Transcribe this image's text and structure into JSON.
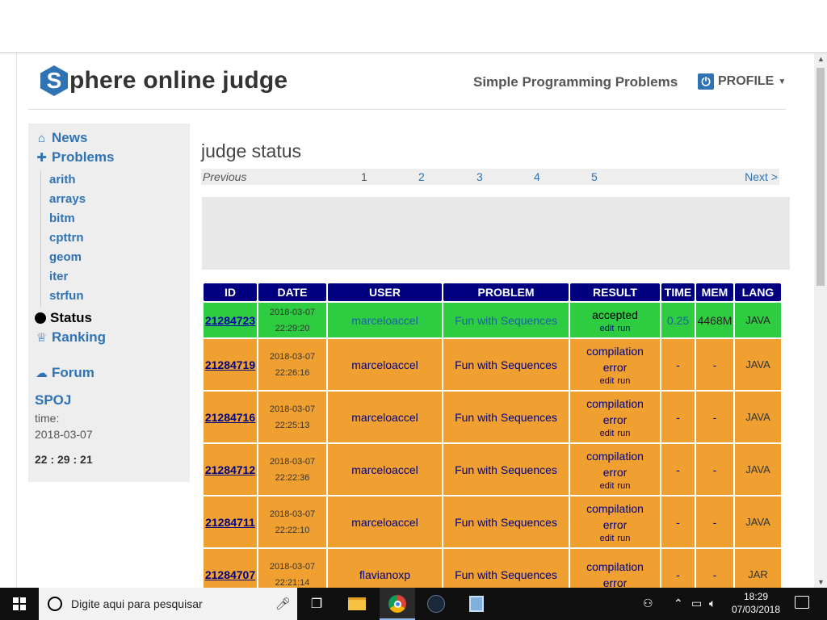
{
  "header": {
    "logo_letter": "S",
    "logo_text": "phere online judge",
    "link": "Simple Programming Problems",
    "profile": "PROFILE"
  },
  "sidebar": {
    "news": "News",
    "problems": "Problems",
    "subs": [
      "arith",
      "arrays",
      "bitm",
      "cpttrn",
      "geom",
      "iter",
      "strfun"
    ],
    "status": "Status",
    "ranking": "Ranking",
    "forum": "Forum",
    "spoj": "SPOJ",
    "time_label": "time:",
    "date": "2018-03-07",
    "clock": "22 : 29 : 21"
  },
  "main": {
    "title": "judge status",
    "pager": {
      "prev": "Previous",
      "pages": [
        "1",
        "2",
        "3",
        "4",
        "5"
      ],
      "next": "Next >"
    }
  },
  "table": {
    "headers": [
      "ID",
      "DATE",
      "USER",
      "PROBLEM",
      "RESULT",
      "TIME",
      "MEM",
      "LANG"
    ],
    "edit_label": "edit",
    "run_label": "run",
    "rows": [
      {
        "id": "21284723",
        "date": "2018-03-07",
        "time_of_day": "22:29:20",
        "user": "marceloaccel",
        "problem": "Fun with Sequences",
        "result": "accepted",
        "time": "0.25",
        "mem": "4468M",
        "lang": "JAVA",
        "status": "accepted"
      },
      {
        "id": "21284719",
        "date": "2018-03-07",
        "time_of_day": "22:26:16",
        "user": "marceloaccel",
        "problem": "Fun with Sequences",
        "result": "compilation error",
        "time": "-",
        "mem": "-",
        "lang": "JAVA",
        "status": "error"
      },
      {
        "id": "21284716",
        "date": "2018-03-07",
        "time_of_day": "22:25:13",
        "user": "marceloaccel",
        "problem": "Fun with Sequences",
        "result": "compilation error",
        "time": "-",
        "mem": "-",
        "lang": "JAVA",
        "status": "error"
      },
      {
        "id": "21284712",
        "date": "2018-03-07",
        "time_of_day": "22:22:36",
        "user": "marceloaccel",
        "problem": "Fun with Sequences",
        "result": "compilation error",
        "time": "-",
        "mem": "-",
        "lang": "JAVA",
        "status": "error"
      },
      {
        "id": "21284711",
        "date": "2018-03-07",
        "time_of_day": "22:22:10",
        "user": "marceloaccel",
        "problem": "Fun with Sequences",
        "result": "compilation error",
        "time": "-",
        "mem": "-",
        "lang": "JAVA",
        "status": "error"
      },
      {
        "id": "21284707",
        "date": "2018-03-07",
        "time_of_day": "22:21:14",
        "user": "flavianoxp",
        "problem": "Fun with Sequences",
        "result": "compilation error",
        "time": "-",
        "mem": "-",
        "lang": "JAR",
        "status": "error"
      }
    ]
  },
  "taskbar": {
    "search_placeholder": "Digite aqui para pesquisar",
    "time": "18:29",
    "date": "07/03/2018"
  }
}
